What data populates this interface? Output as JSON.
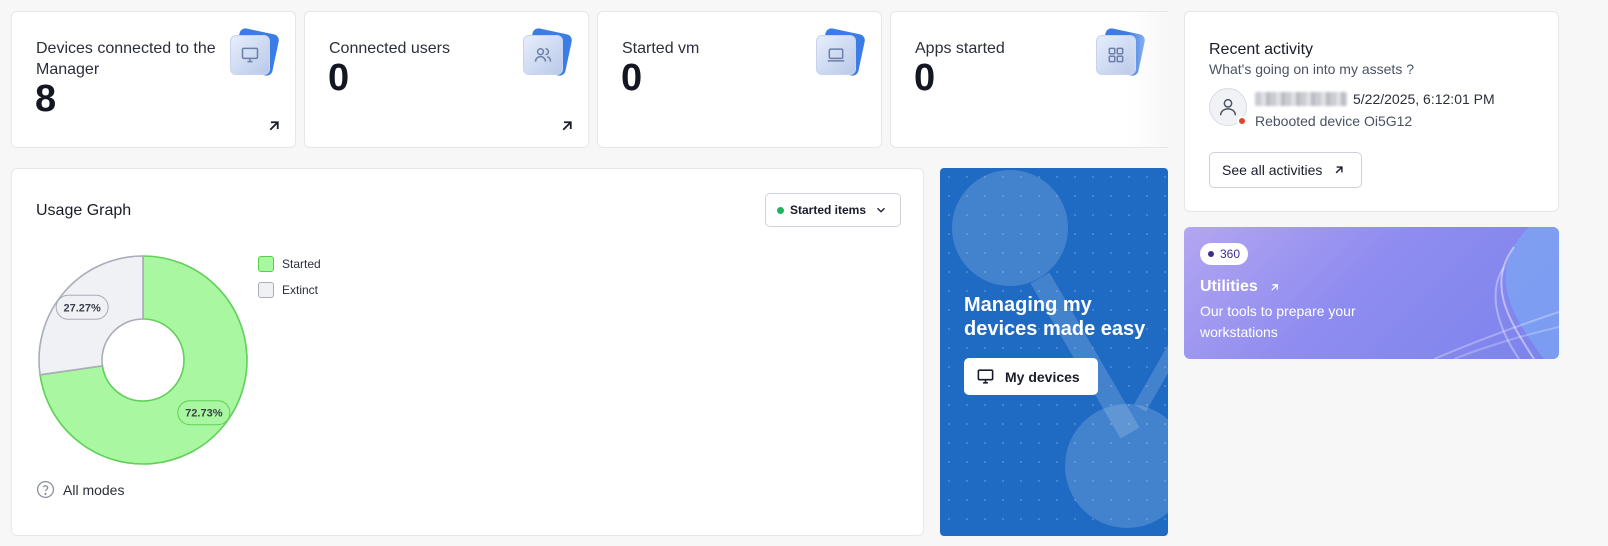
{
  "stats": [
    {
      "label": "Devices connected to the Manager",
      "value": "8",
      "icon": "monitor-icon"
    },
    {
      "label": "Connected users",
      "value": "0",
      "icon": "users-icon"
    },
    {
      "label": "Started vm",
      "value": "0",
      "icon": "laptop-icon"
    },
    {
      "label": "Apps started",
      "value": "0",
      "icon": "grid-icon"
    }
  ],
  "usage": {
    "title": "Usage Graph",
    "filter_label": "Started items",
    "footer_label": "All modes",
    "colors": {
      "started": "#aaf7a2",
      "extinct": "#f0f1f4"
    }
  },
  "chart_data": {
    "type": "pie",
    "categories": [
      "Started",
      "Extinct"
    ],
    "values": [
      72.73,
      27.27
    ],
    "labels": [
      "72.73%",
      "27.27%"
    ],
    "legend": [
      "Started",
      "Extinct"
    ]
  },
  "promo": {
    "title": "Managing my devices made easy",
    "button_label": "My devices",
    "color": "#1f6bc4"
  },
  "activity": {
    "title": "Recent activity",
    "subtitle": "What's going on into my assets ?",
    "timestamp": "5/22/2025, 6:12:01 PM",
    "description": "Rebooted device Oi5G12",
    "button_label": "See all activities"
  },
  "utilities": {
    "badge": "360",
    "title": "Utilities",
    "description": "Our tools to prepare your workstations"
  }
}
